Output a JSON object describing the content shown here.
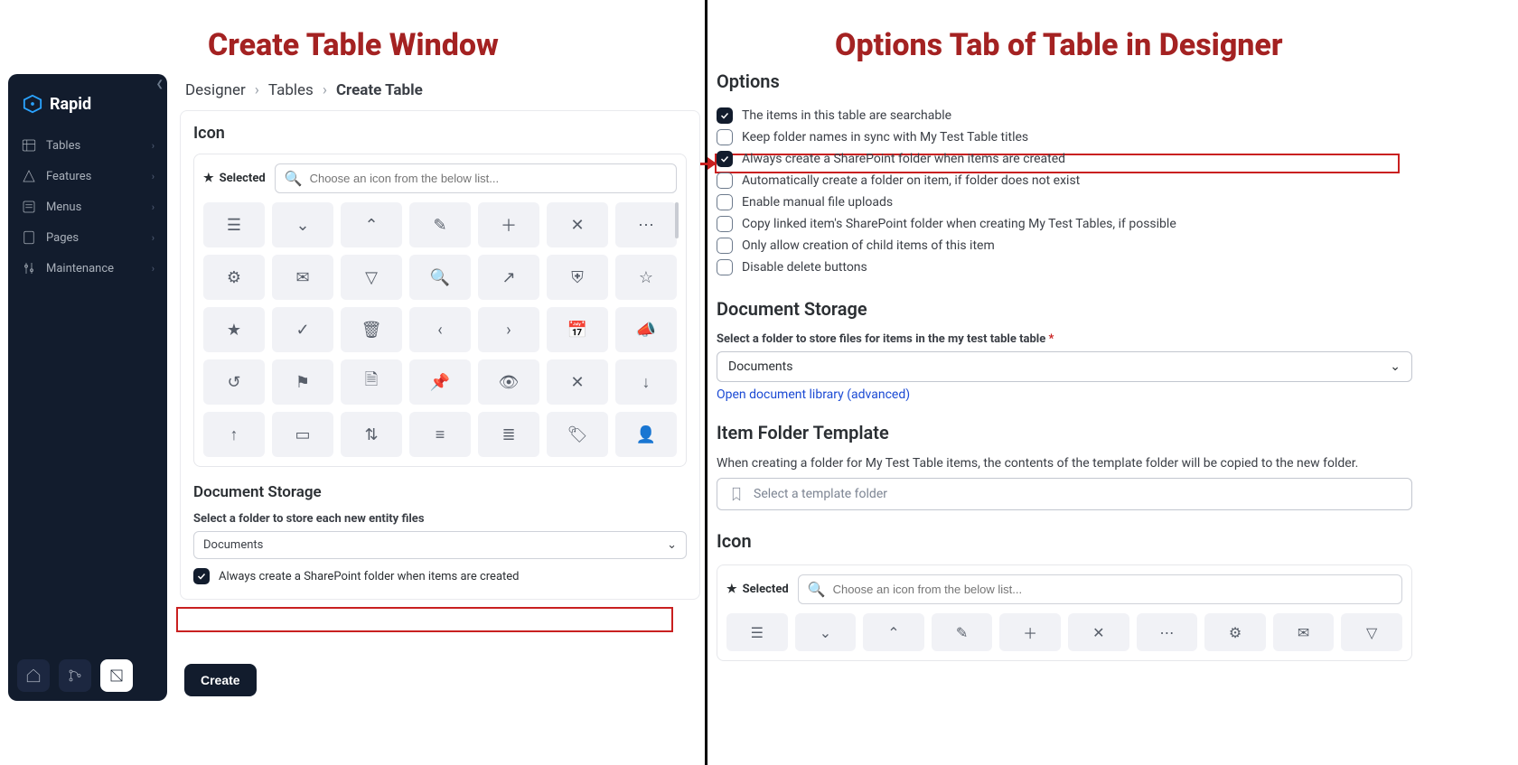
{
  "titles": {
    "left": "Create Table Window",
    "right": "Options Tab of Table in Designer"
  },
  "brand": "Rapid",
  "sidebar": [
    {
      "label": "Tables"
    },
    {
      "label": "Features"
    },
    {
      "label": "Menus"
    },
    {
      "label": "Pages"
    },
    {
      "label": "Maintenance"
    }
  ],
  "breadcrumbs": {
    "a": "Designer",
    "b": "Tables",
    "c": "Create Table"
  },
  "icon_section": {
    "title": "Icon",
    "selected_label": "Selected",
    "search_placeholder": "Choose an icon from the below list...",
    "doc_storage_title": "Document Storage",
    "doc_storage_label": "Select a folder to store each new entity files",
    "folder_value": "Documents",
    "chk_label": "Always create a SharePoint folder when items are created",
    "create_btn": "Create"
  },
  "right": {
    "options_title": "Options",
    "options": [
      {
        "checked": true,
        "label": "The items in this table are searchable"
      },
      {
        "checked": false,
        "label": "Keep folder names in sync with My Test Table titles"
      },
      {
        "checked": true,
        "label": "Always create a SharePoint folder when items are created"
      },
      {
        "checked": false,
        "label": "Automatically create a folder on item, if folder does not exist"
      },
      {
        "checked": false,
        "label": "Enable manual file uploads"
      },
      {
        "checked": false,
        "label": "Copy linked item's SharePoint folder when creating My Test Tables, if possible"
      },
      {
        "checked": false,
        "label": "Only allow creation of child items of this item"
      },
      {
        "checked": false,
        "label": "Disable delete buttons"
      }
    ],
    "doc_storage": {
      "title": "Document Storage",
      "label": "Select a folder to store files for items in the my test table table",
      "value": "Documents",
      "link": "Open document library (advanced)"
    },
    "template": {
      "title": "Item Folder Template",
      "note": "When creating a folder for My Test Table items, the contents of the template folder will be copied to the new folder.",
      "placeholder": "Select a template folder"
    },
    "icon": {
      "title": "Icon",
      "selected_label": "Selected",
      "search_placeholder": "Choose an icon from the below list..."
    }
  }
}
